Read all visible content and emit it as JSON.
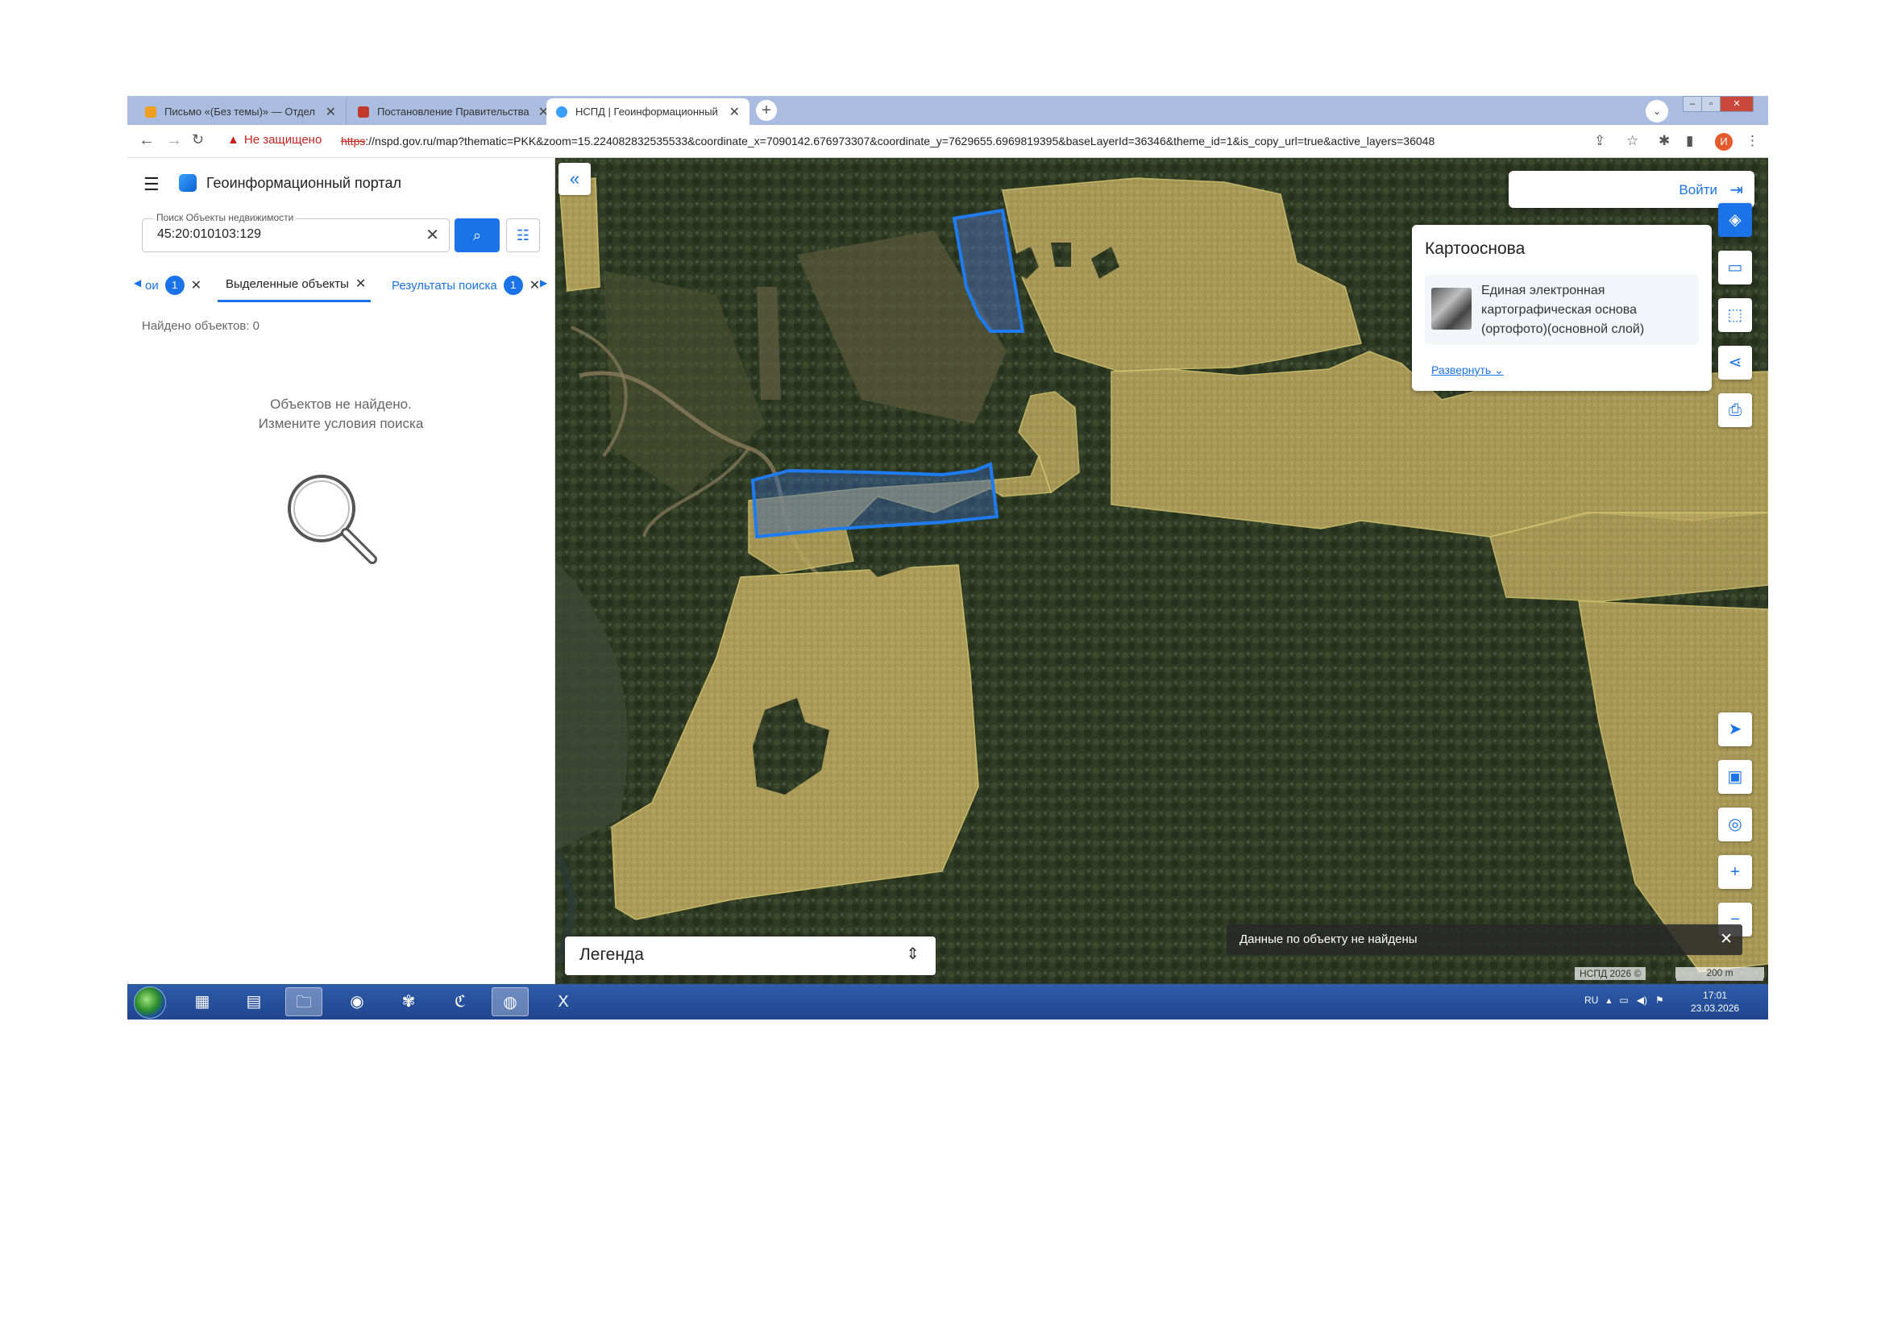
{
  "browser": {
    "tabs": [
      {
        "title": "Письмо «(Без темы)» — Отдел а",
        "fav_color": "#f0a020"
      },
      {
        "title": "Постановление Правительства",
        "fav_color": "#c0392b"
      },
      {
        "title": "НСПД | Геоинформационный п",
        "fav_color": "#3aa0ff",
        "active": true
      }
    ],
    "new_tab": "+",
    "security_warning": "Не защищено",
    "url_scheme": "https",
    "url_rest": "://nspd.gov.ru/map?thematic=PKK&zoom=15.224082832535533&coordinate_x=7090142.676973307&coordinate_y=7629655.6969819395&baseLayerId=36346&theme_id=1&is_copy_url=true&active_layers=36048",
    "profile_initial": "И"
  },
  "portal": {
    "title": "Геоинформационный портал",
    "search": {
      "label": "Поиск Объекты недвижимости",
      "value": "45:20:010103:129"
    },
    "tabs": {
      "first_partial": "ои",
      "first_count": "1",
      "selected": "Выделенные объекты",
      "results": "Результаты поиска",
      "results_count": "1"
    },
    "found_text": "Найдено объектов: 0",
    "empty_line1": "Объектов не найдено.",
    "empty_line2": "Измените условия поиска"
  },
  "map": {
    "login": "Войти",
    "basemap": {
      "heading": "Картооснова",
      "layer_name": "Единая электронная картографическая основа (ортофото)(основной слой)",
      "expand": "Развернуть"
    },
    "legend": "Легенда",
    "toast": "Данные по объекту не найдены",
    "copyright": "НСПД 2026 ©",
    "scale": "200 m",
    "colors": {
      "field": "#c9b66a",
      "forest": "#2f3b25",
      "highlight": "#1e7cf0",
      "accent": "#1a73e8"
    }
  },
  "taskbar": {
    "lang": "RU",
    "time": "17:01",
    "date": "23.03.2026"
  }
}
